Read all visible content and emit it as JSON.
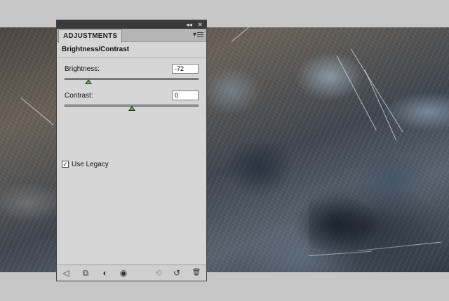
{
  "panel": {
    "tab_label": "ADJUSTMENTS",
    "collapse_icon": "◂◂",
    "close_icon": "✕",
    "menu_icon": "▾",
    "section_title": "Brightness/Contrast"
  },
  "controls": {
    "brightness": {
      "label": "Brightness:",
      "value": "-72",
      "level": 0.18
    },
    "contrast": {
      "label": "Contrast:",
      "value": "0",
      "level": 0.5
    }
  },
  "legacy": {
    "label": "Use Legacy",
    "checked": true,
    "check_glyph": "✓"
  },
  "footer_icons": {
    "back": "◁",
    "expand": "⧉",
    "clip": "◐",
    "visibility": "◉",
    "previous_state": "⟲",
    "reset": "↺",
    "trash": "🗑"
  },
  "colors": {
    "thumb_fill": "#6fbf3a",
    "panel_bg": "#d6d6d6",
    "titlebar": "#3a3a3a"
  }
}
